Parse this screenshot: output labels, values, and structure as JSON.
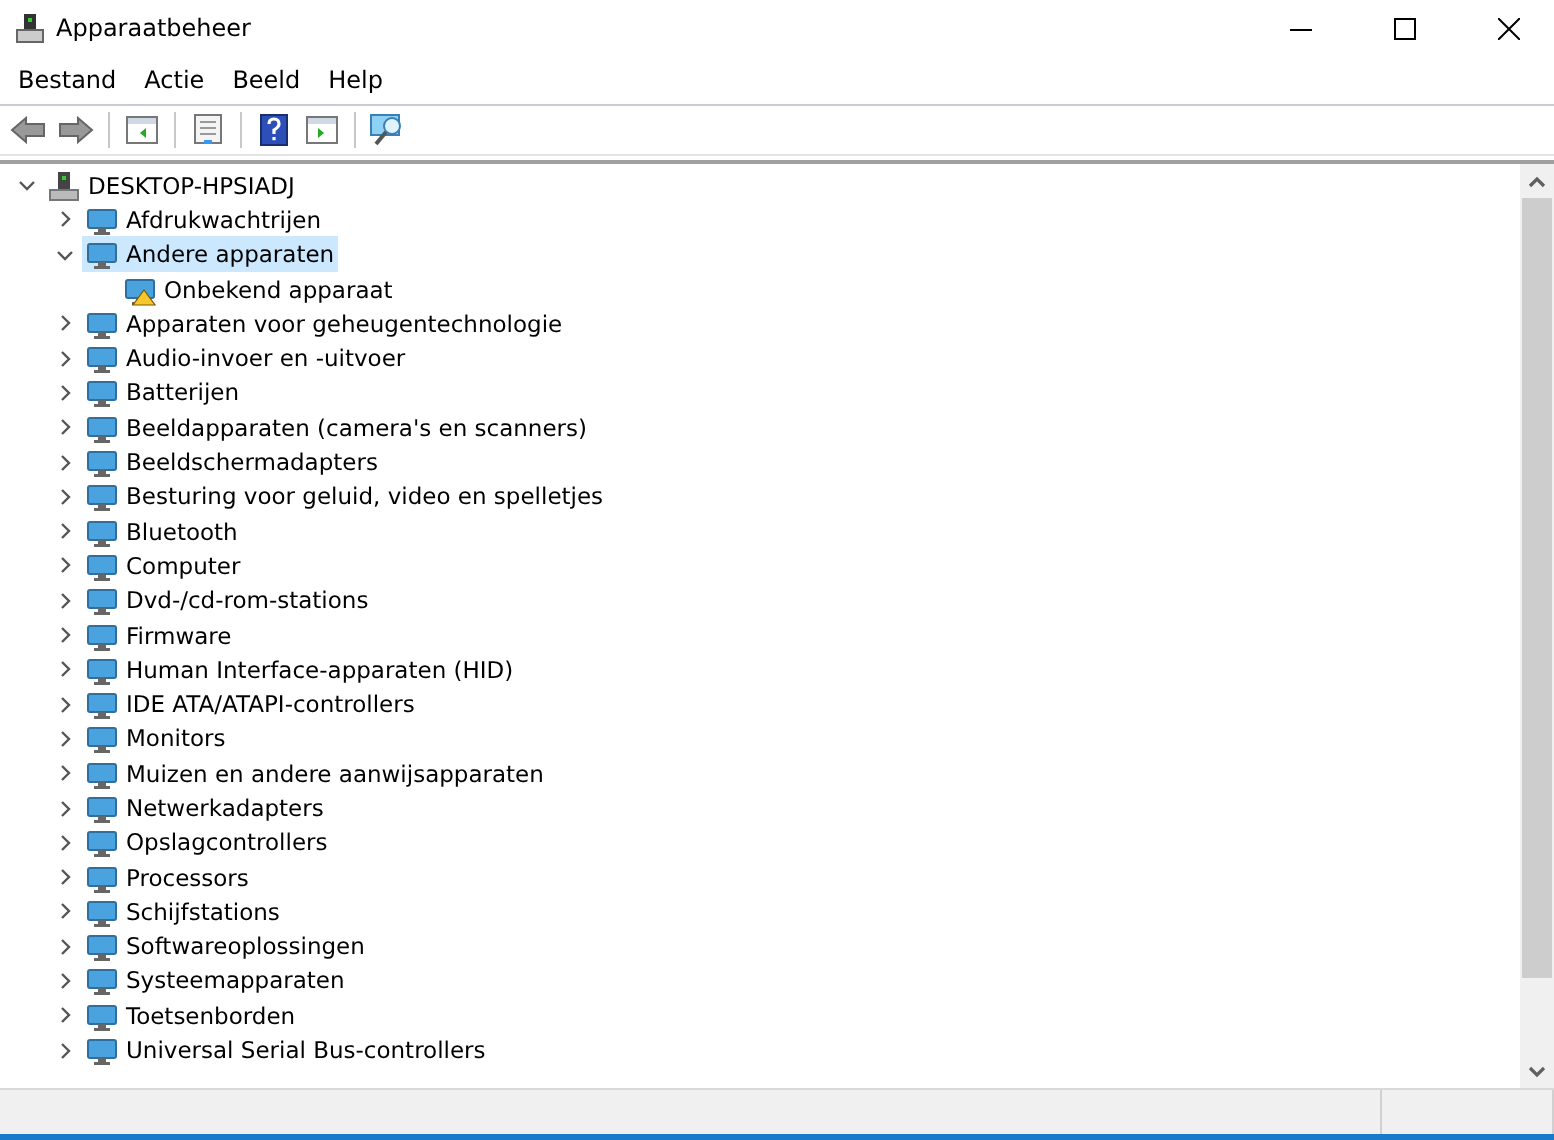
{
  "window": {
    "title": "Apparaatbeheer"
  },
  "menu": [
    "Bestand",
    "Actie",
    "Beeld",
    "Help"
  ],
  "tree": [
    {
      "label": "DESKTOP-HPSIADJ",
      "expanded": true,
      "selected": false,
      "children": [
        {
          "label": "Afdrukwachtrijen",
          "expanded": false,
          "selected": false
        },
        {
          "label": "Andere apparaten",
          "expanded": true,
          "selected": true,
          "children": [
            {
              "label": "Onbekend apparaat",
              "selected": false,
              "warning": true
            }
          ]
        },
        {
          "label": "Apparaten voor geheugentechnologie",
          "expanded": false,
          "selected": false
        },
        {
          "label": "Audio-invoer en -uitvoer",
          "expanded": false,
          "selected": false
        },
        {
          "label": "Batterijen",
          "expanded": false,
          "selected": false
        },
        {
          "label": "Beeldapparaten (camera's en scanners)",
          "expanded": false,
          "selected": false
        },
        {
          "label": "Beeldschermadapters",
          "expanded": false,
          "selected": false
        },
        {
          "label": "Besturing voor geluid, video en spelletjes",
          "expanded": false,
          "selected": false
        },
        {
          "label": "Bluetooth",
          "expanded": false,
          "selected": false
        },
        {
          "label": "Computer",
          "expanded": false,
          "selected": false
        },
        {
          "label": "Dvd-/cd-rom-stations",
          "expanded": false,
          "selected": false
        },
        {
          "label": "Firmware",
          "expanded": false,
          "selected": false
        },
        {
          "label": "Human Interface-apparaten (HID)",
          "expanded": false,
          "selected": false
        },
        {
          "label": "IDE ATA/ATAPI-controllers",
          "expanded": false,
          "selected": false
        },
        {
          "label": "Monitors",
          "expanded": false,
          "selected": false
        },
        {
          "label": "Muizen en andere aanwijsapparaten",
          "expanded": false,
          "selected": false
        },
        {
          "label": "Netwerkadapters",
          "expanded": false,
          "selected": false
        },
        {
          "label": "Opslagcontrollers",
          "expanded": false,
          "selected": false
        },
        {
          "label": "Processors",
          "expanded": false,
          "selected": false
        },
        {
          "label": "Schijfstations",
          "expanded": false,
          "selected": false
        },
        {
          "label": "Softwareoplossingen",
          "expanded": false,
          "selected": false
        },
        {
          "label": "Systeemapparaten",
          "expanded": false,
          "selected": false
        },
        {
          "label": "Toetsenborden",
          "expanded": false,
          "selected": false
        },
        {
          "label": "Universal Serial Bus-controllers",
          "expanded": false,
          "selected": false
        }
      ]
    }
  ]
}
